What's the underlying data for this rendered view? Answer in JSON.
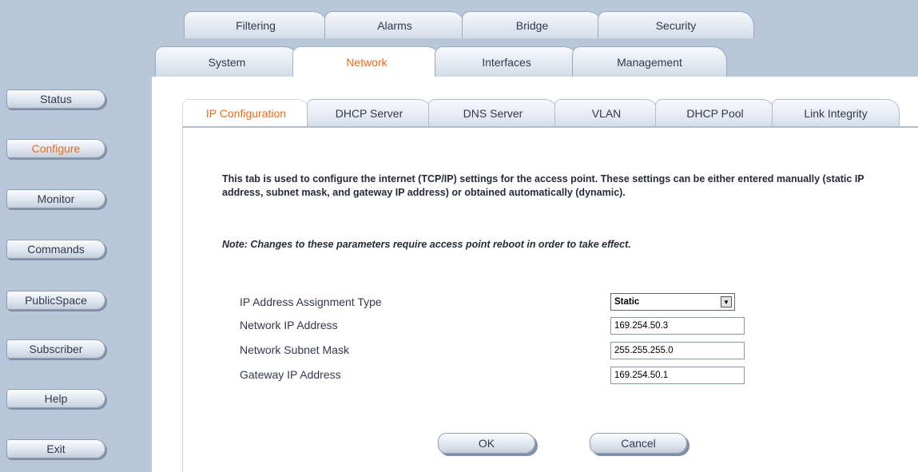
{
  "sidebar": {
    "items": [
      {
        "label": "Status"
      },
      {
        "label": "Configure",
        "active": true
      },
      {
        "label": "Monitor"
      },
      {
        "label": "Commands"
      },
      {
        "label": "PublicSpace"
      },
      {
        "label": "Subscriber"
      },
      {
        "label": "Help"
      },
      {
        "label": "Exit"
      }
    ]
  },
  "top_tabs": {
    "row1": [
      "Filtering",
      "Alarms",
      "Bridge",
      "Security"
    ],
    "row2": [
      "System",
      "Network",
      "Interfaces",
      "Management"
    ],
    "active": "Network"
  },
  "sub_tabs": {
    "items": [
      "IP Configuration",
      "DHCP Server",
      "DNS Server",
      "VLAN",
      "DHCP Pool",
      "Link Integrity"
    ],
    "active": "IP Configuration"
  },
  "content": {
    "intro": "This tab is used to configure the internet (TCP/IP) settings for the access point. These settings can be either entered manually (static IP address, subnet mask, and gateway IP address) or obtained automatically (dynamic).",
    "note": "Note: Changes to these parameters require access point reboot in order to take effect."
  },
  "form": {
    "assignment_type_label": "IP Address Assignment Type",
    "assignment_type_value": "Static",
    "ip_label": "Network IP Address",
    "ip_value": "169.254.50.3",
    "mask_label": "Network Subnet Mask",
    "mask_value": "255.255.255.0",
    "gateway_label": "Gateway IP Address",
    "gateway_value": "169.254.50.1"
  },
  "buttons": {
    "ok": "OK",
    "cancel": "Cancel"
  },
  "colors": {
    "nav_background": "#b9c7da",
    "active_text": "#ee6a17",
    "text": "#33384a"
  }
}
